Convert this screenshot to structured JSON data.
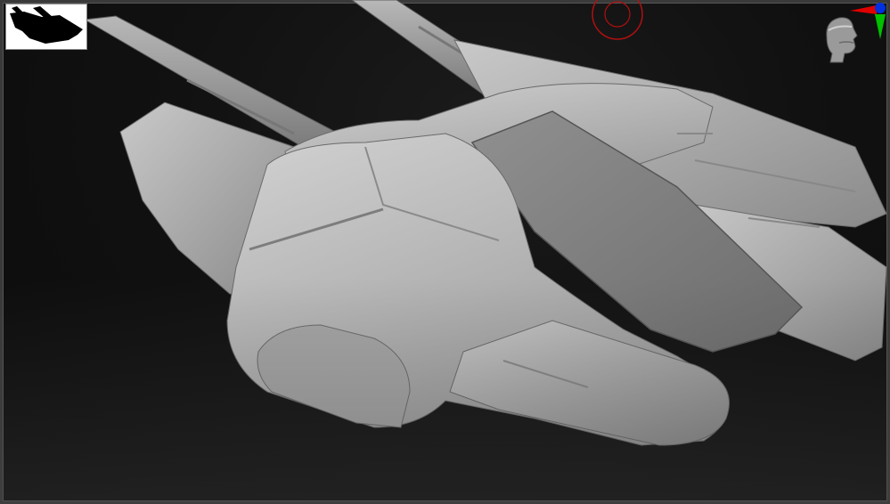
{
  "app": {
    "title": "",
    "viewport_label": ""
  },
  "viewport": {
    "background_top": "#0c0c0c",
    "background_bottom": "#3b3b3b",
    "model_color": "#b9b9b9"
  },
  "thumbnail": {
    "icon": "ship-silhouette-icon"
  },
  "draw_size_gizmo": {
    "icon": "brush-circle-icon",
    "color": "#b01010"
  },
  "navigation_gizmo": {
    "icon": "head-orientation-icon",
    "axes": [
      {
        "name": "x",
        "color": "#e00000"
      },
      {
        "name": "y",
        "color": "#00c000"
      },
      {
        "name": "z",
        "color": "#0020e0"
      }
    ]
  }
}
